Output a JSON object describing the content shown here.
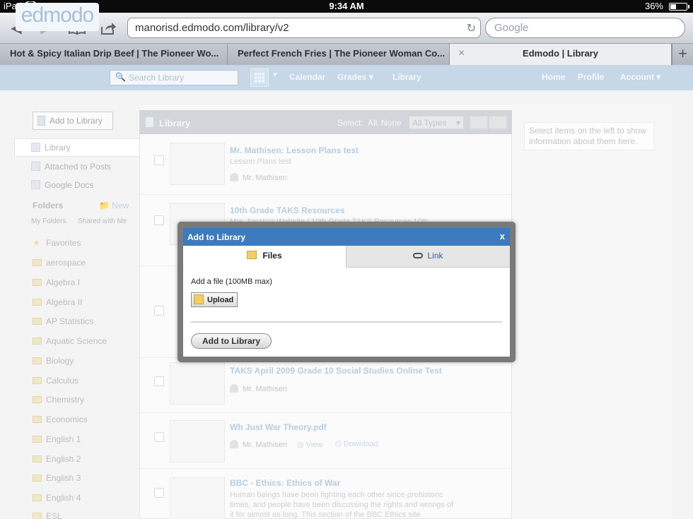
{
  "status_bar": {
    "carrier": "iPad",
    "time": "9:34 AM",
    "battery": "36%",
    "battery_level": 0.36
  },
  "safari": {
    "url": "manorisd.edmodo.com/library/v2",
    "search_placeholder": "Google",
    "tabs": [
      {
        "title": "Hot & Spicy Italian Drip Beef | The Pioneer Wo..."
      },
      {
        "title": "Perfect French Fries | The Pioneer Woman Co..."
      },
      {
        "title": "Edmodo | Library",
        "active": true
      }
    ],
    "new_tab_label": "+",
    "close_tab_label": "×"
  },
  "edmodo_header": {
    "logo": "edmodo",
    "search_placeholder": "Search Library",
    "nav": [
      "Calendar",
      "Grades",
      "Library",
      "Home",
      "Profile",
      "Account"
    ]
  },
  "sidebar": {
    "add_button": "Add to Library",
    "items": [
      "Library",
      "Attached to Posts",
      "Google Docs"
    ],
    "folders_heading": "Folders",
    "new_label": "New",
    "subtabs": [
      "My Folders",
      "Shared with Me"
    ],
    "folders": [
      "Favorites",
      "aerospace",
      "Algebra I",
      "Algebra II",
      "AP Statistics",
      "Aquatic Science",
      "Biology",
      "Calculus",
      "Chemistry",
      "Economics",
      "English 1",
      "English 2",
      "English 3",
      "English 4",
      "ESL"
    ]
  },
  "library": {
    "title": "Library",
    "select_label": "Select:",
    "select_all": "All",
    "select_none": "None",
    "type_filter": "All Types",
    "rows": [
      {
        "title": "Mr. Mathisen: Lesson Plans test",
        "sub": "Lesson Plans test",
        "author": "Mr. Mathisen"
      },
      {
        "title": "10th Grade TAKS Resources",
        "sub": "Mrs. Amato's Website / 10th Grade TAKS Resources 10th",
        "author": ""
      },
      {
        "title": "TAKS April 2009 Grade 10 Social Studies Online Test",
        "sub": "",
        "author": "Mr. Mathisen"
      },
      {
        "title": "Wh Just War Theory.pdf",
        "sub": "",
        "author": "Mr. Mathisen",
        "view": "View",
        "download": "Download"
      },
      {
        "title": "BBC - Ethics: Ethics of War",
        "desc": "Human beings have been fighting each other since prehistoric times, and people have been discussing the rights and wrongs of it for almost as long. This section of the BBC Ethics site"
      }
    ]
  },
  "info_box": "Select items on the left to show information about them here.",
  "modal": {
    "title": "Add to Library",
    "close": "x",
    "tabs": {
      "files": "Files",
      "link": "Link"
    },
    "add_file_label": "Add a file (100MB max)",
    "upload_button": "Upload",
    "submit_button": "Add to Library"
  }
}
